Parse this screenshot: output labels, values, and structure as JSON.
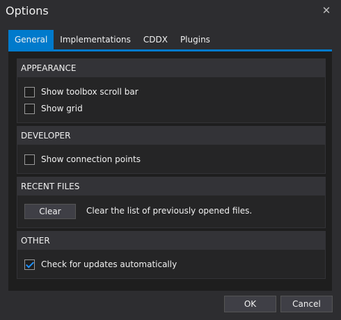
{
  "window": {
    "title": "Options"
  },
  "tabs": [
    "General",
    "Implementations",
    "CDDX",
    "Plugins"
  ],
  "groups": {
    "appearance": {
      "title": "APPEARANCE",
      "options": [
        {
          "label": "Show toolbox scroll bar",
          "checked": false
        },
        {
          "label": "Show grid",
          "checked": false
        }
      ]
    },
    "developer": {
      "title": "DEVELOPER",
      "options": [
        {
          "label": "Show connection points",
          "checked": false
        }
      ]
    },
    "recent_files": {
      "title": "RECENT FILES",
      "clear_label": "Clear",
      "clear_description": "Clear the list of previously opened files."
    },
    "other": {
      "title": "OTHER",
      "options": [
        {
          "label": "Check for updates automatically",
          "checked": true
        }
      ]
    }
  },
  "footer": {
    "ok_label": "OK",
    "cancel_label": "Cancel"
  },
  "icons": {
    "close": "close-icon",
    "checkmark": "checkmark-icon"
  },
  "colors": {
    "accent": "#007acc",
    "check": "#1e90ff",
    "background": "#2d2d30",
    "panel": "#1e1e1e"
  }
}
